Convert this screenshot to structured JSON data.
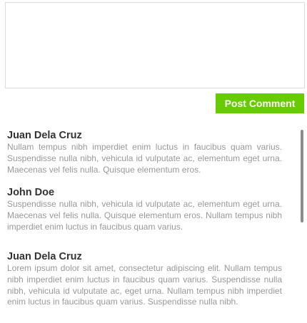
{
  "comment_form": {
    "textarea_value": "",
    "post_label": "Post Comment",
    "accent_color": "#66cc00"
  },
  "comments": [
    {
      "author": "Juan Dela Cruz",
      "text": "Nullam tempus nibh imperdiet enim luctus in faucibus quam varius. Suspendisse nulla nibh, vehicula id vulputate ac, elementum eget urna. Maecenas vel felis nulla. Quisque elementum eros."
    },
    {
      "author": "John Doe",
      "text": "Suspendisse nulla nibh, vehicula id vulputate ac, elementum eget urna. Maecenas vel felis nulla. Quisque elementum eros. Nullam tempus nibh imperdiet enim luctus in faucibus quam varius."
    },
    {
      "author": "Juan Dela Cruz",
      "text": "Lorem ipsum dolor sit amet, consectetur adipiscing elit. Nullam tempus nibh imperdiet enim luctus in faucibus quam varius. Suspendisse nulla nibh, vehicula id vulputate ac, eget urna. Nullam tempus nibh imperdiet enim luctus in faucibus quam varius. Suspendisse nulla nibh."
    }
  ]
}
